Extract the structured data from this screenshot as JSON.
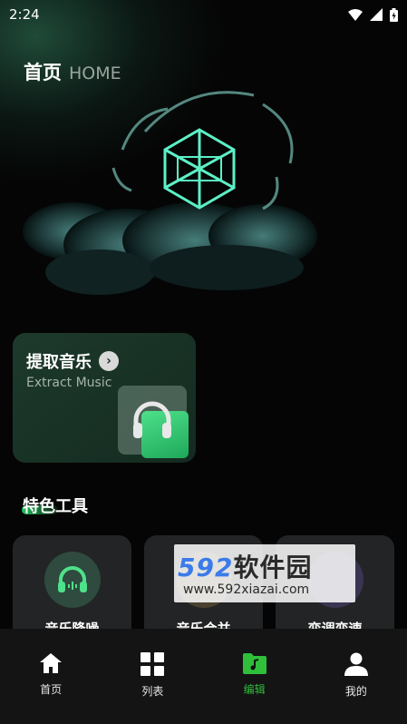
{
  "status_bar": {
    "time": "2:24"
  },
  "header": {
    "title_cn": "首页",
    "title_en": "HOME"
  },
  "extract_card": {
    "title": "提取音乐",
    "subtitle": "Extract Music"
  },
  "section": {
    "title": "特色工具"
  },
  "tools": [
    {
      "label": "音乐降噪",
      "icon": "headphone-icon"
    },
    {
      "label": "音乐合并",
      "icon": "merge-icon"
    },
    {
      "label": "变调变速",
      "icon": "pitch-icon"
    }
  ],
  "watermark": {
    "brand": "592",
    "cn": "软件园",
    "url": "www.592xiazai.com"
  },
  "tab_bar": {
    "tabs": [
      {
        "label": "首页",
        "icon": "home-icon"
      },
      {
        "label": "列表",
        "icon": "grid-icon"
      },
      {
        "label": "编辑",
        "icon": "folder-music-icon",
        "active": true
      },
      {
        "label": "我的",
        "icon": "user-icon"
      }
    ]
  },
  "colors": {
    "accent": "#2fbf3b",
    "card": "#222425",
    "background": "#050505"
  }
}
